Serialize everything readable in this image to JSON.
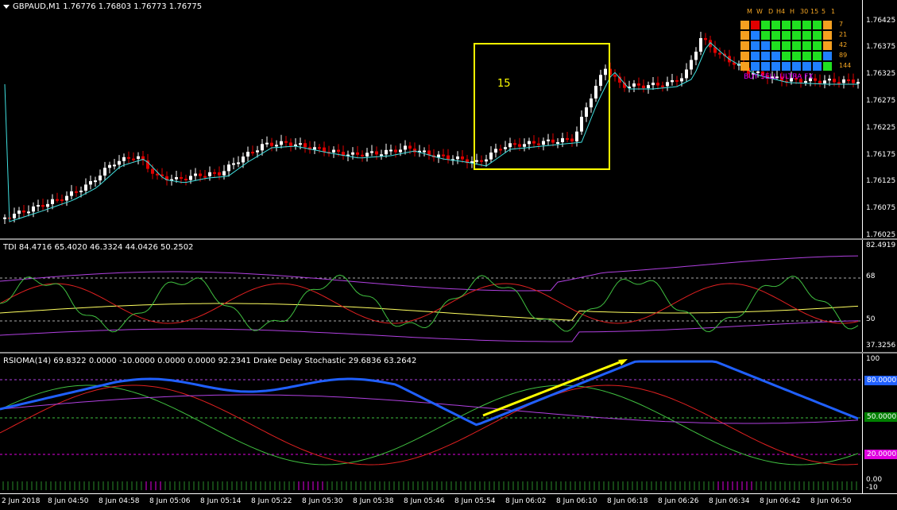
{
  "price_pane": {
    "header": "GBPAUD,M1  1.76776 1.76803 1.76773 1.76775",
    "box_label": "15",
    "price_ticks": [
      "1.76425",
      "1.76375",
      "1.76325",
      "1.76275",
      "1.76225",
      "1.76175",
      "1.76125",
      "1.76075",
      "1.76025"
    ],
    "mtf_panel": {
      "headers": [
        "M",
        "W",
        "D",
        "H4",
        "H",
        "30",
        "15",
        "5",
        "1"
      ],
      "periods": [
        "7",
        "21",
        "42",
        "89",
        "144"
      ],
      "signal_text": "BUY SELL ULTRA FX",
      "grid": [
        [
          "orange",
          "red",
          "green",
          "green",
          "green",
          "green",
          "green",
          "green",
          "orange"
        ],
        [
          "orange",
          "blue",
          "green",
          "green",
          "green",
          "green",
          "green",
          "green",
          "orange"
        ],
        [
          "orange",
          "blue",
          "blue",
          "green",
          "green",
          "green",
          "green",
          "green",
          "orange"
        ],
        [
          "orange",
          "blue",
          "blue",
          "blue",
          "green",
          "green",
          "green",
          "green",
          "blue"
        ],
        [
          "orange",
          "blue",
          "blue",
          "blue",
          "blue",
          "blue",
          "blue",
          "blue",
          "green"
        ]
      ]
    }
  },
  "tdi_pane": {
    "header": "TDI 84.4716 65.4020 46.3324 44.0426 50.2502",
    "ticks": [
      "82.4919",
      "68",
      "50",
      "37.3256"
    ]
  },
  "rsioma_pane": {
    "header": "RSIOMA(14) 69.8322 0.0000 -10.0000 0.0000 0.0000 92.2341  Drake Delay Stochastic 29.6836 63.2642",
    "ticks": [
      "100",
      "80.0000",
      "50.0000",
      "20.0000",
      "0.00",
      "-10"
    ]
  },
  "time_axis": [
    "2 Jun 2018",
    "8 Jun 04:50",
    "8 Jun 04:58",
    "8 Jun 05:06",
    "8 Jun 05:14",
    "8 Jun 05:22",
    "8 Jun 05:30",
    "8 Jun 05:38",
    "8 Jun 05:46",
    "8 Jun 05:54",
    "8 Jun 06:02",
    "8 Jun 06:10",
    "8 Jun 06:18",
    "8 Jun 06:26",
    "8 Jun 06:34",
    "8 Jun 06:42",
    "8 Jun 06:50"
  ],
  "colors": {
    "bull": "#ffffff",
    "bear": "#e00000",
    "ma": "#40e0e0",
    "box": "#ffff00",
    "purple": "#b040e0",
    "yellow": "#ffff60",
    "green": "#40c040",
    "red": "#e02020",
    "blue": "#2060ff",
    "tag_blue": "#2060ff",
    "tag_green": "#008000",
    "tag_magenta": "#e000e0"
  }
}
